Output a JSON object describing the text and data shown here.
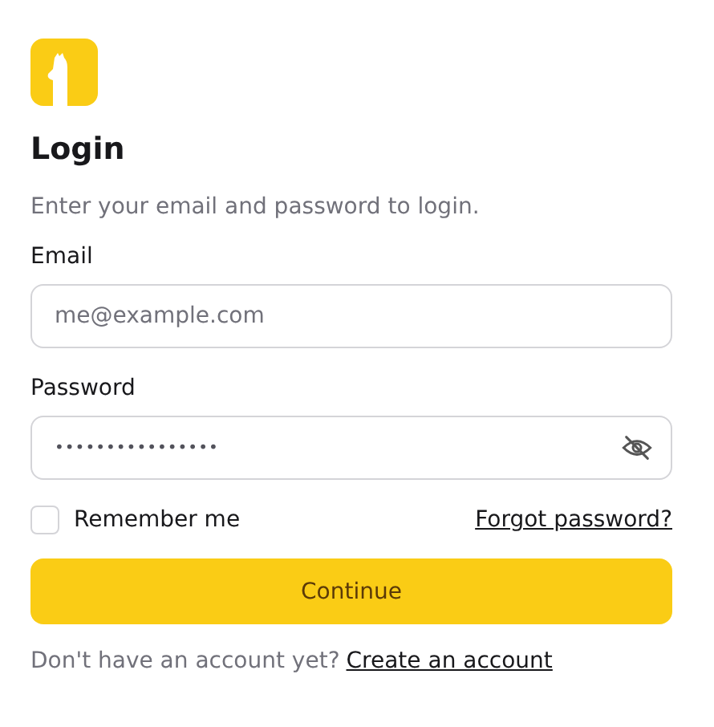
{
  "title": "Login",
  "subtitle": "Enter your email and password to login.",
  "fields": [
    {
      "kind": "email",
      "label": "Email",
      "placeholder": "me@example.com"
    },
    {
      "kind": "password",
      "label": "Password",
      "value": "••••••••••••••••",
      "revealed": false
    }
  ],
  "remember": {
    "label": "Remember me",
    "checked": false
  },
  "forgot_link": "Forgot password?",
  "submit": "Continue",
  "footer": {
    "text": "Don't have an account yet?",
    "link": "Create an account"
  }
}
